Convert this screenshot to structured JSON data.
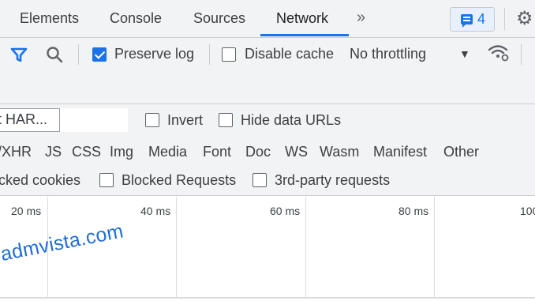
{
  "tabs": {
    "elements": "Elements",
    "console": "Console",
    "sources": "Sources",
    "network": "Network",
    "more": "»"
  },
  "issues_badge": {
    "count": "4"
  },
  "toolbar": {
    "preserve_log": "Preserve log",
    "disable_cache": "Disable cache",
    "throttling": "No throttling"
  },
  "filter": {
    "input_value": "t HAR...",
    "invert": "Invert",
    "hide_data_urls": "Hide data URLs"
  },
  "type_filters": [
    "/XHR",
    "JS",
    "CSS",
    "Img",
    "Media",
    "Font",
    "Doc",
    "WS",
    "Wasm",
    "Manifest",
    "Other"
  ],
  "blocked": {
    "blocked_cookies": "cked cookies",
    "blocked_requests": "Blocked Requests",
    "third_party": "3rd-party requests"
  },
  "timeline": {
    "ticks": [
      "20 ms",
      "40 ms",
      "60 ms",
      "80 ms",
      "100"
    ]
  },
  "watermark": "admvista.com",
  "colors": {
    "accent": "#1a73e8",
    "watermark": "#1f6dd6"
  }
}
